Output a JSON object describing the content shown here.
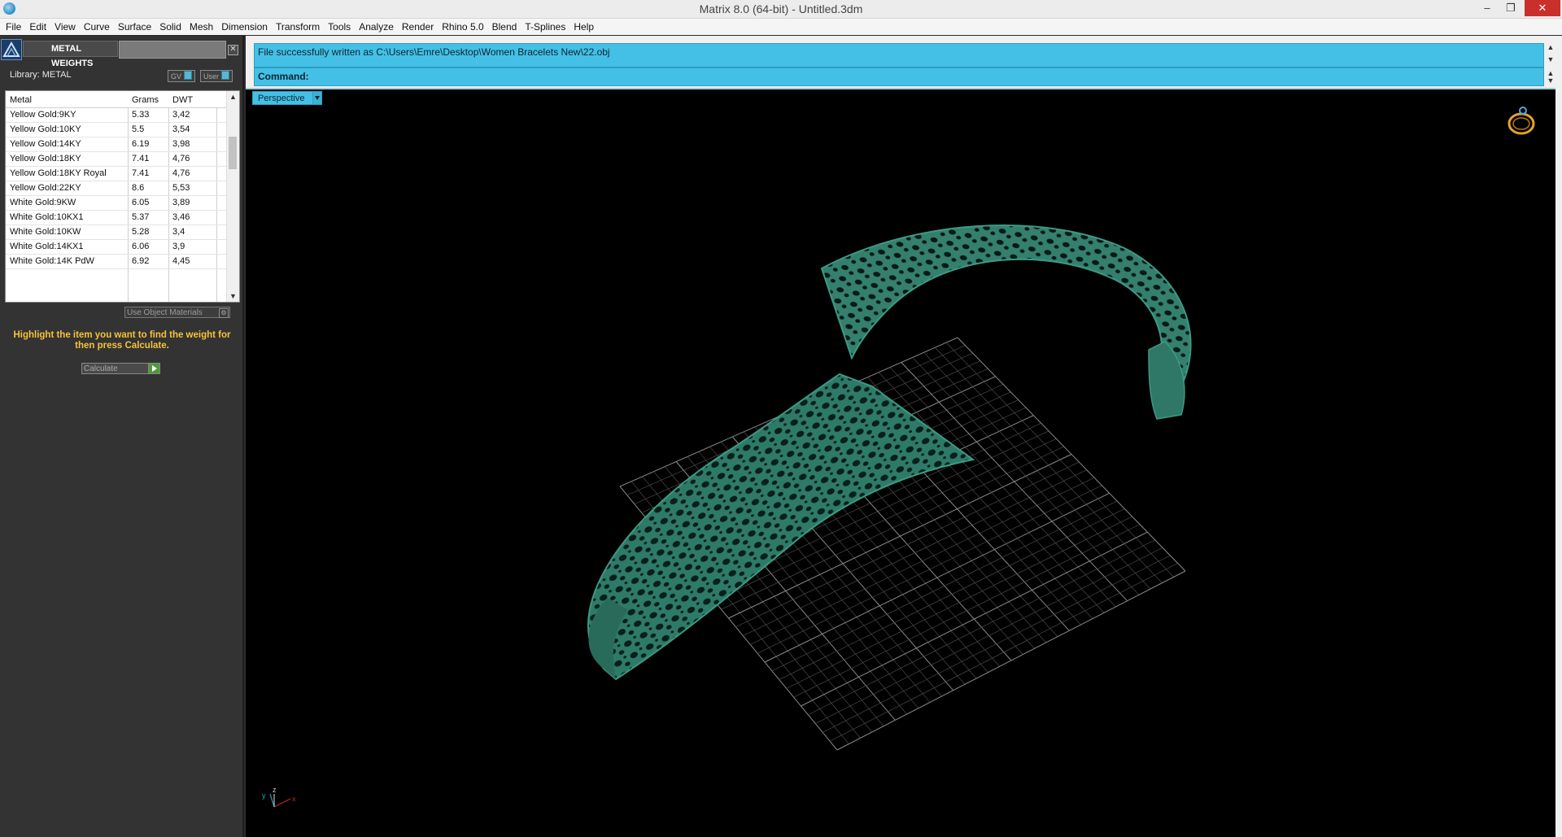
{
  "window": {
    "title": "Matrix 8.0 (64-bit) - Untitled.3dm",
    "minimize_glyph": "–",
    "restore_glyph": "❐",
    "close_glyph": "✕"
  },
  "menu": [
    "File",
    "Edit",
    "View",
    "Curve",
    "Surface",
    "Solid",
    "Mesh",
    "Dimension",
    "Transform",
    "Tools",
    "Analyze",
    "Render",
    "Rhino 5.0",
    "Blend",
    "T-Splines",
    "Help"
  ],
  "panel": {
    "title": "METAL WEIGHTS",
    "close_glyph": "✕",
    "library_label": "Library: METAL",
    "gv_label": "GV",
    "user_label": "User",
    "columns": [
      "Metal",
      "Grams",
      "DWT"
    ],
    "rows": [
      {
        "metal": "Yellow Gold:9KY",
        "grams": "5.33",
        "dwt": "3,42"
      },
      {
        "metal": "Yellow Gold:10KY",
        "grams": "5.5",
        "dwt": "3,54"
      },
      {
        "metal": "Yellow Gold:14KY",
        "grams": "6.19",
        "dwt": "3,98"
      },
      {
        "metal": "Yellow Gold:18KY",
        "grams": "7.41",
        "dwt": "4,76"
      },
      {
        "metal": "Yellow Gold:18KY Royal",
        "grams": "7.41",
        "dwt": "4,76"
      },
      {
        "metal": "Yellow Gold:22KY",
        "grams": "8.6",
        "dwt": "5,53"
      },
      {
        "metal": "White Gold:9KW",
        "grams": "6.05",
        "dwt": "3,89"
      },
      {
        "metal": "White Gold:10KX1",
        "grams": "5.37",
        "dwt": "3,46"
      },
      {
        "metal": "White Gold:10KW",
        "grams": "5.28",
        "dwt": "3,4"
      },
      {
        "metal": "White Gold:14KX1",
        "grams": "6.06",
        "dwt": "3,9"
      },
      {
        "metal": "White Gold:14K PdW",
        "grams": "6.92",
        "dwt": "4,45"
      }
    ],
    "use_object_materials": "Use Object Materials",
    "hint": "Highlight the item you want to find the weight for then press Calculate.",
    "calculate_label": "Calculate"
  },
  "command": {
    "output": "File successfully written as C:\\Users\\Emre\\Desktop\\Women Bracelets New\\22.obj",
    "prompt": "Command:"
  },
  "viewport": {
    "name": "Perspective",
    "axis_labels": {
      "x": "x",
      "y": "y",
      "z": "z"
    }
  },
  "colors": {
    "accent_blue": "#44c0e6",
    "hint_yellow": "#f6c23a",
    "model_green": "#2e7a68",
    "grid": "#8a8a8a",
    "axis_x": "#c0281f",
    "axis_y": "#2aa0c8"
  }
}
